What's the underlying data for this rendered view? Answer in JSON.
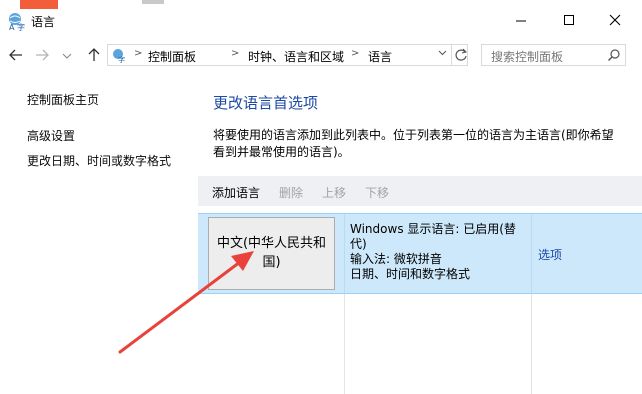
{
  "window": {
    "title": "语言",
    "minimize_icon": "minimize-icon",
    "maximize_icon": "maximize-icon",
    "close_icon": "close-icon"
  },
  "nav": {
    "back_icon": "back-arrow-icon",
    "forward_icon": "forward-arrow-icon",
    "up_icon": "up-arrow-icon",
    "breadcrumb": [
      "控制面板",
      "时钟、语言和区域",
      "语言"
    ],
    "search_placeholder": "搜索控制面板"
  },
  "sidebar": {
    "home": "控制面板主页",
    "links": [
      "高级设置",
      "更改日期、时间或数字格式"
    ]
  },
  "main": {
    "heading": "更改语言首选项",
    "description": "将要使用的语言添加到此列表中。位于列表第一位的语言为主语言(即你希望看到并最常使用的语言)。",
    "toolbar": {
      "add": "添加语言",
      "remove": "删除",
      "move_up": "上移",
      "move_down": "下移"
    },
    "language": {
      "name": "中文(中华人民共和国)",
      "display_status": "Windows 显示语言: 已启用(替代)",
      "input_method": "输入法: 微软拼音",
      "date_format": "日期、时间和数字格式",
      "options": "选项"
    }
  },
  "colors": {
    "heading_blue": "#1c4aa5",
    "selection_bg": "#cde8fa",
    "arrow_red": "#e8423a"
  }
}
